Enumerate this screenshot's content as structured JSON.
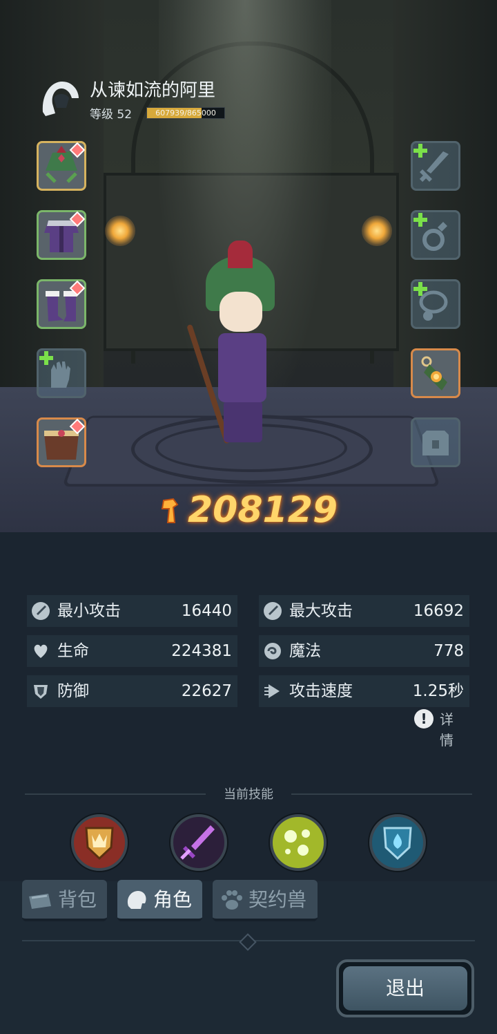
{
  "player": {
    "name": "从谏如流的阿里",
    "level_label": "等级 52",
    "xp_text": "607939/865000",
    "xp_current": 607939,
    "xp_max": 865000
  },
  "power": "208129",
  "stats": {
    "min_attack": {
      "label": "最小攻击",
      "value": "16440"
    },
    "max_attack": {
      "label": "最大攻击",
      "value": "16692"
    },
    "hp": {
      "label": "生命",
      "value": "224381"
    },
    "mana": {
      "label": "魔法",
      "value": "778"
    },
    "defense": {
      "label": "防御",
      "value": "22627"
    },
    "attack_speed": {
      "label": "攻击速度",
      "value": "1.25秒"
    }
  },
  "details_label": "详情",
  "skills_title": "当前技能",
  "tabs": {
    "bag": "背包",
    "character": "角色",
    "pet": "契约兽"
  },
  "exit_label": "退出",
  "colors": {
    "power_text": "#ffd66b",
    "xp_fill": "#d7a93b",
    "slot_green_border": "#7bb66a",
    "slot_gold_border": "#d6b35f",
    "slot_orange_border": "#d88a4a",
    "plus_green": "#7be04a"
  },
  "equipment": {
    "left": [
      "helmet",
      "armor",
      "boots",
      "gloves-empty",
      "belt"
    ],
    "right": [
      "weapon-empty",
      "ring-empty",
      "necklace-empty",
      "amulet",
      "bag-locked"
    ]
  }
}
